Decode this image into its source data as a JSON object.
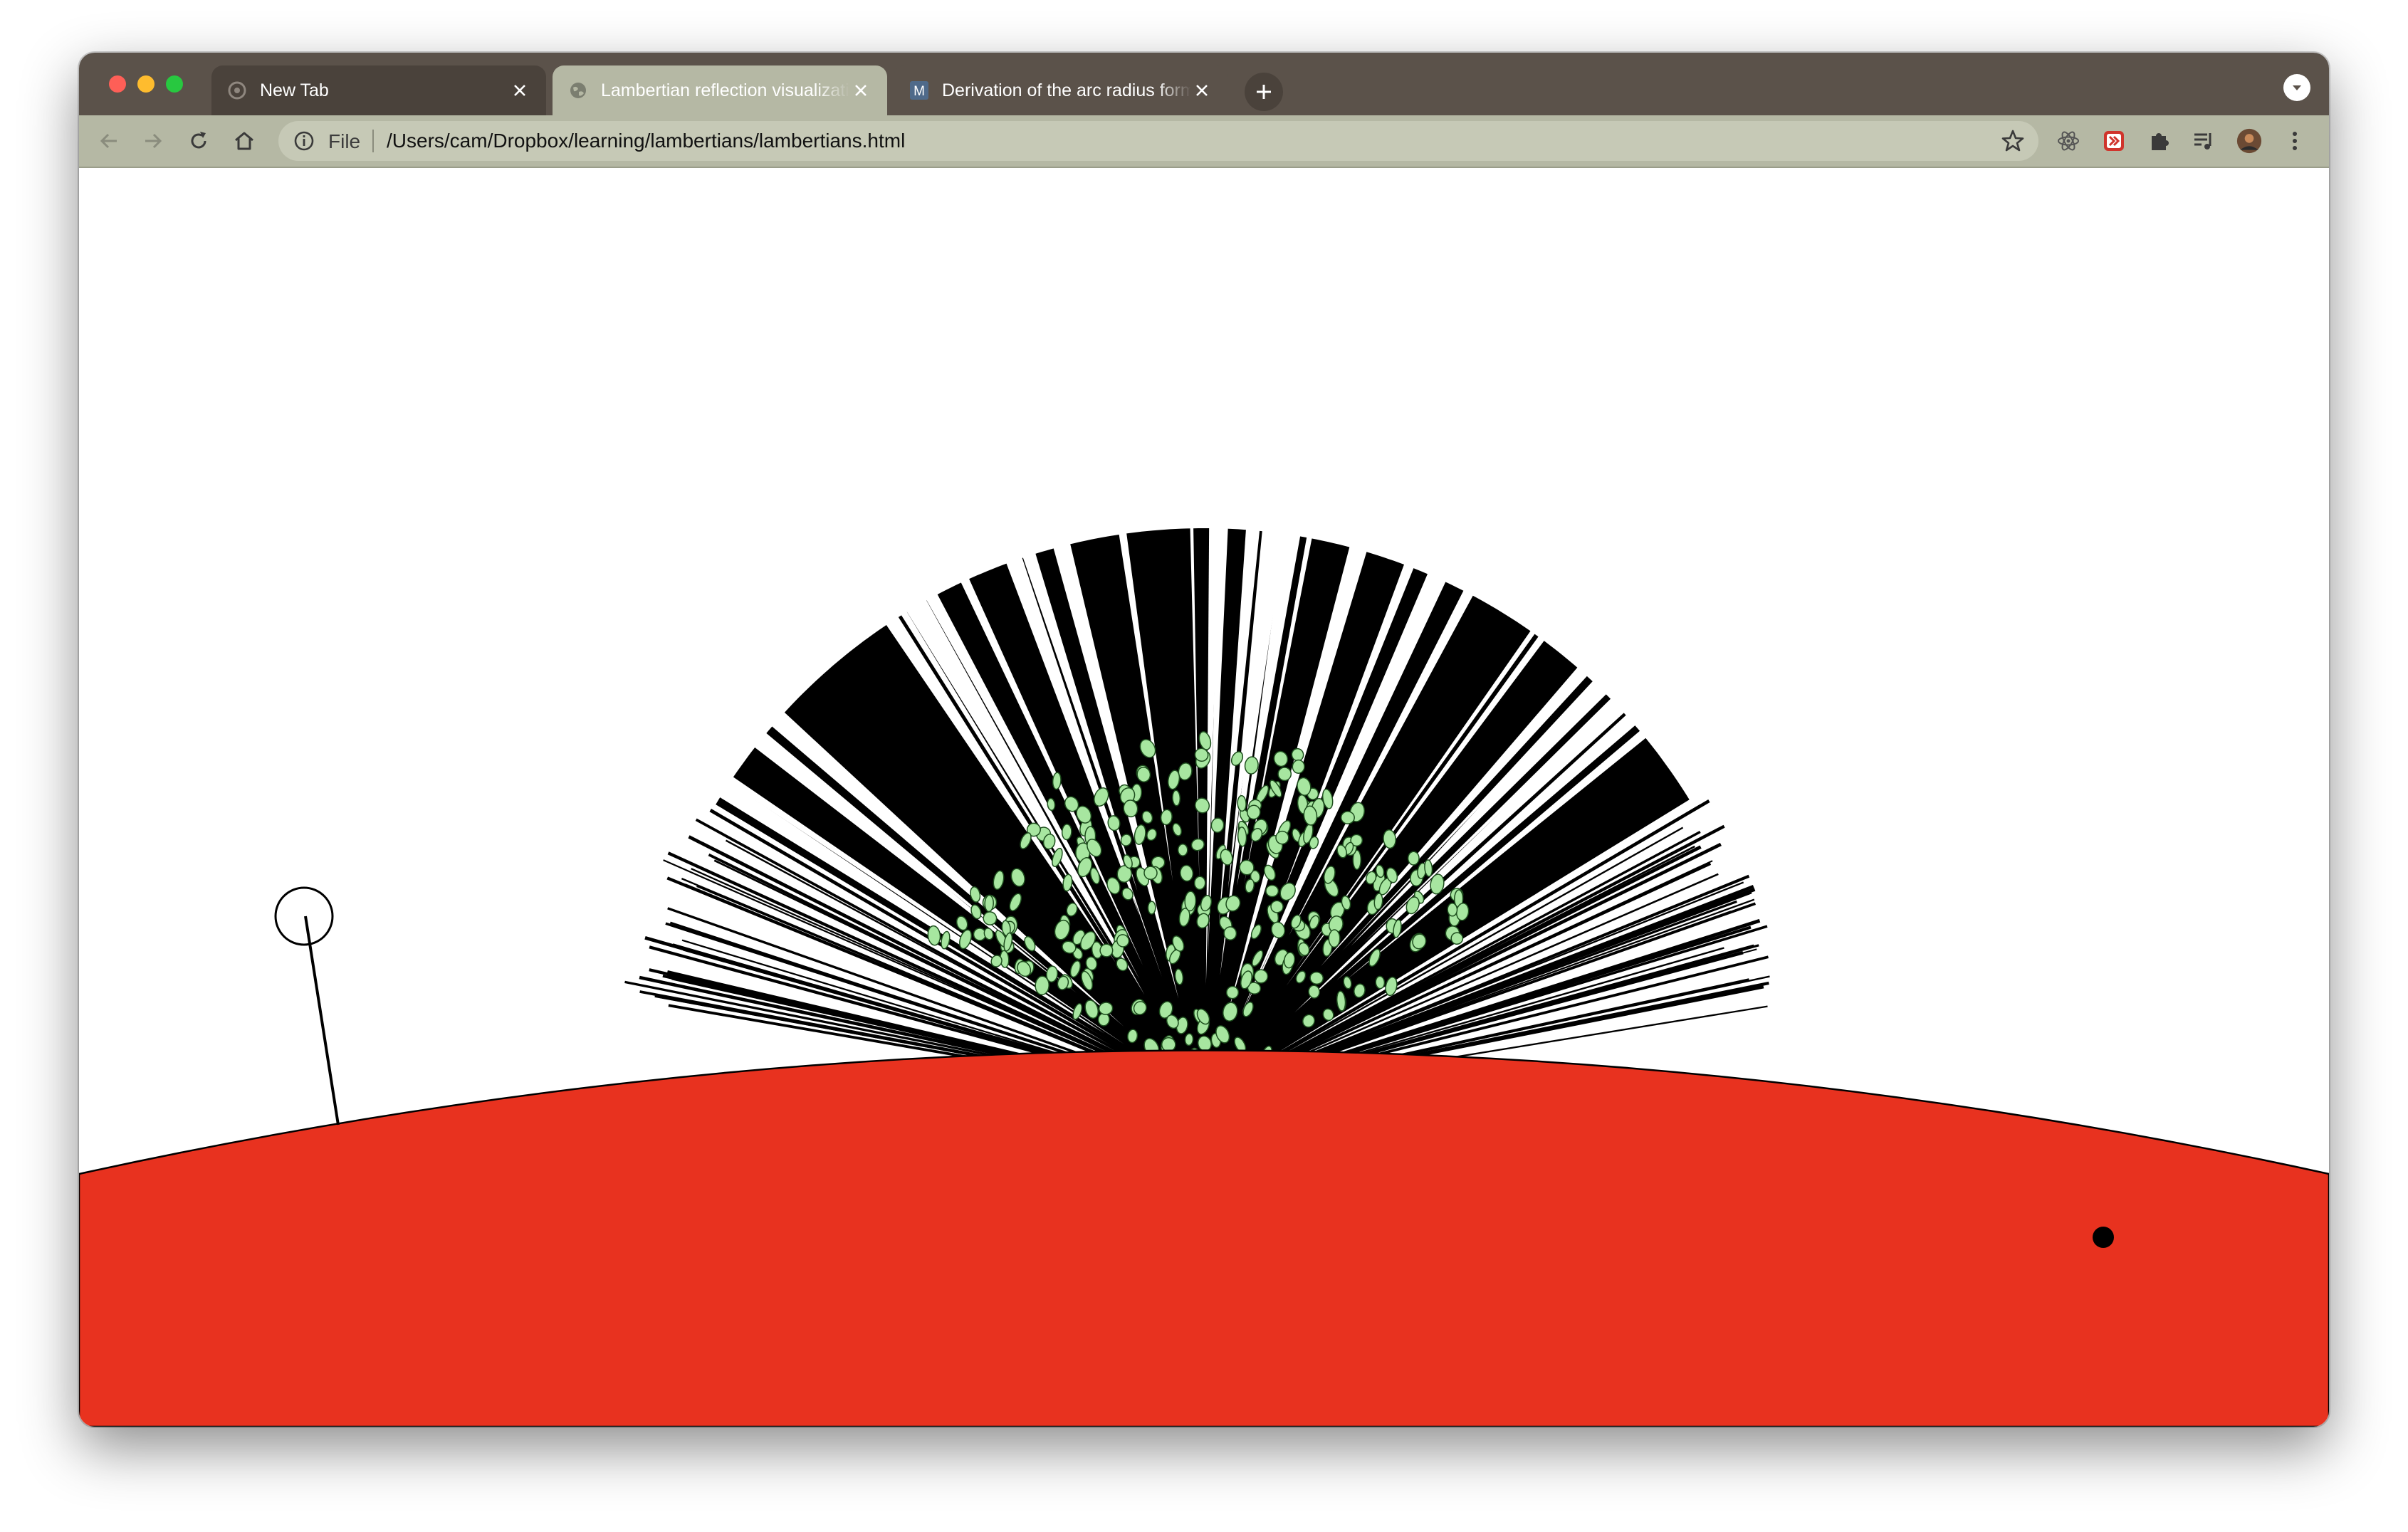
{
  "browser": {
    "tabs": [
      {
        "title": "New Tab",
        "favicon": "chrome-icon",
        "active": false
      },
      {
        "title": "Lambertian reflection visualization",
        "favicon": "globe-icon",
        "active": true
      },
      {
        "title": "Derivation of the arc radius formula",
        "favicon": "M",
        "active": false
      }
    ],
    "address": {
      "scheme_label": "File",
      "url": "/Users/cam/Dropbox/learning/lambertians/lambertians.html"
    },
    "extensions": [
      "react-devtools-icon",
      "red-extension-icon",
      "puzzle-icon",
      "media-queue-icon"
    ],
    "colors": {
      "tabstrip": "#5b524a",
      "active_tab": "#b5b8a4",
      "toolbar": "#b5b8a4"
    }
  },
  "scene": {
    "surface_color": "#e8321f",
    "ray_color": "#000000",
    "particle_fill": "#a7e6a0",
    "particle_stroke": "#1d4d1d"
  }
}
